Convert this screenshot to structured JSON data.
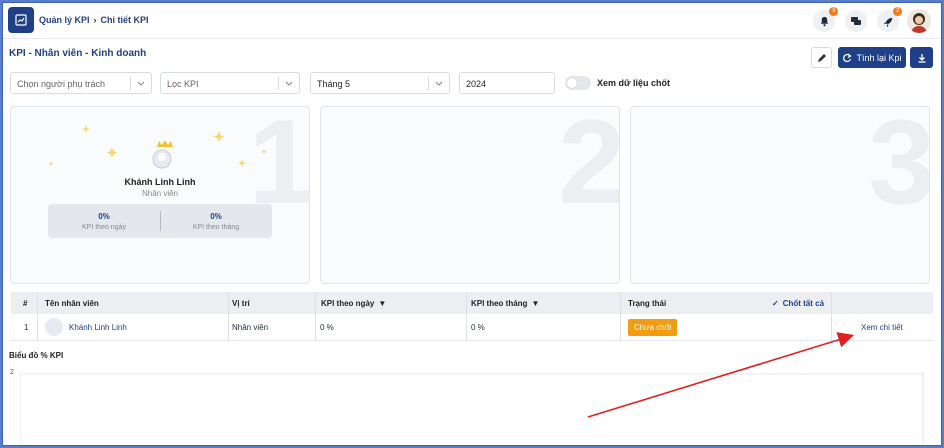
{
  "breadcrumb": {
    "root": "Quản lý KPI",
    "current": "Chi tiết KPI"
  },
  "topbar_icons": [
    {
      "name": "bell-icon",
      "badge": "3"
    },
    {
      "name": "chat-icon",
      "badge": ""
    },
    {
      "name": "rocket-icon",
      "badge": "2"
    }
  ],
  "page": {
    "title": "KPI - Nhân viên - Kinh doanh",
    "recalc_label": "Tính lại Kpi"
  },
  "filters": {
    "assignee_placeholder": "Chọn người phụ trách",
    "kpi_placeholder": "Lọc KPI",
    "month_value": "Tháng 5",
    "year_value": "2024",
    "toggle_label": "Xem dữ liệu chốt"
  },
  "podium": [
    {
      "rank": "1",
      "name": "Khánh Linh Linh",
      "role": "Nhân viên",
      "kpi_day": "0%",
      "kpi_day_label": "KPI theo ngày",
      "kpi_month": "0%",
      "kpi_month_label": "KPI theo tháng"
    },
    {
      "rank": "2"
    },
    {
      "rank": "3"
    }
  ],
  "table": {
    "headers": {
      "index": "#",
      "name": "Tên nhân viên",
      "position": "Vị trí",
      "kpi_day": "KPI theo ngày",
      "kpi_month": "KPI theo tháng",
      "status": "Trạng thái",
      "close_all": "Chốt tất cả"
    },
    "rows": [
      {
        "index": "1",
        "name": "Khánh Linh Linh",
        "position": "Nhân viên",
        "kpi_day": "0 %",
        "kpi_month": "0 %",
        "status": "Chưa chốt",
        "action": "Xem chi tiết"
      }
    ]
  },
  "chart": {
    "title": "Biểu đồ % KPI"
  },
  "chart_data": {
    "type": "bar",
    "categories": [],
    "values": [],
    "title": "Biểu đồ % KPI",
    "yticks": [
      "2"
    ]
  },
  "colors": {
    "primary": "#1f3f86",
    "status_pending": "#f39c12",
    "annotation_arrow": "#e02020"
  }
}
